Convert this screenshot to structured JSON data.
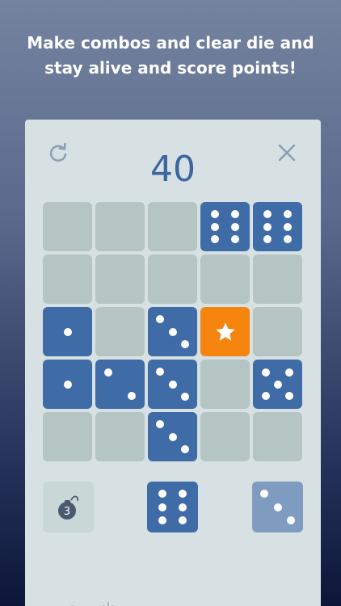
{
  "promo": {
    "line1": "Make combos and clear die and",
    "line2": "stay alive and score points!"
  },
  "game": {
    "score": "40",
    "icons": {
      "restart": "restart-icon",
      "close": "close-icon",
      "special": "star-icon",
      "bomb": "bomb-icon"
    },
    "colors": {
      "die": "#3f6ba6",
      "empty": "#b4c5c4",
      "special": "#f6850f",
      "queued": "#7f9cc0",
      "score": "#3b679e"
    },
    "board": [
      [
        0,
        0,
        0,
        6,
        6
      ],
      [
        0,
        0,
        0,
        0,
        0
      ],
      [
        1,
        0,
        3,
        "star",
        0
      ],
      [
        1,
        2,
        3,
        0,
        5
      ],
      [
        0,
        0,
        3,
        0,
        0
      ]
    ],
    "tray": {
      "bomb_count": "3",
      "next_die": 6,
      "queued_die": 3
    }
  }
}
